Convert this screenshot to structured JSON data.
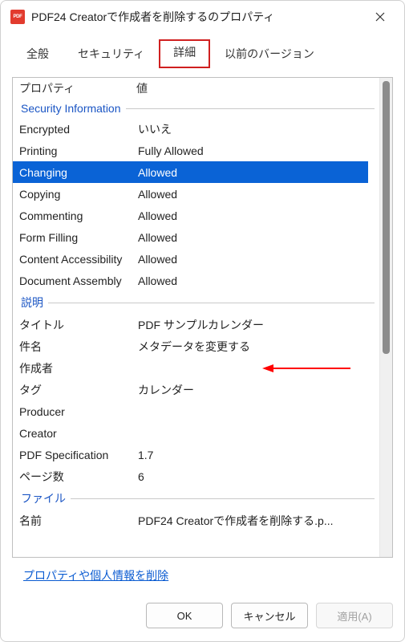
{
  "window": {
    "title": "PDF24 Creatorで作成者を削除するのプロパティ"
  },
  "tabs": {
    "general": "全般",
    "security": "セキュリティ",
    "details": "詳細",
    "previous": "以前のバージョン"
  },
  "columns": {
    "property": "プロパティ",
    "value": "値"
  },
  "sections": {
    "security": "Security Information",
    "description": "説明",
    "file": "ファイル"
  },
  "security_rows": {
    "encrypted": {
      "label": "Encrypted",
      "value": "いいえ"
    },
    "printing": {
      "label": "Printing",
      "value": "Fully Allowed"
    },
    "changing": {
      "label": "Changing",
      "value": "Allowed"
    },
    "copying": {
      "label": "Copying",
      "value": "Allowed"
    },
    "commenting": {
      "label": "Commenting",
      "value": "Allowed"
    },
    "form_filling": {
      "label": "Form Filling",
      "value": "Allowed"
    },
    "content_access": {
      "label": "Content Accessibility",
      "value": "Allowed"
    },
    "doc_assembly": {
      "label": "Document Assembly",
      "value": "Allowed"
    }
  },
  "desc_rows": {
    "title": {
      "label": "タイトル",
      "value": "PDF サンプルカレンダー"
    },
    "subject": {
      "label": "件名",
      "value": "メタデータを変更する"
    },
    "author": {
      "label": "作成者",
      "value": ""
    },
    "tags": {
      "label": "タグ",
      "value": "カレンダー"
    },
    "producer": {
      "label": "Producer",
      "value": ""
    },
    "creator": {
      "label": "Creator",
      "value": ""
    },
    "pdf_spec": {
      "label": "PDF Specification",
      "value": "1.7"
    },
    "pages": {
      "label": "ページ数",
      "value": "6"
    }
  },
  "file_rows": {
    "name": {
      "label": "名前",
      "value": "PDF24 Creatorで作成者を削除する.p..."
    }
  },
  "link": {
    "remove": "プロパティや個人情報を削除"
  },
  "buttons": {
    "ok": "OK",
    "cancel": "キャンセル",
    "apply": "適用(A)"
  }
}
